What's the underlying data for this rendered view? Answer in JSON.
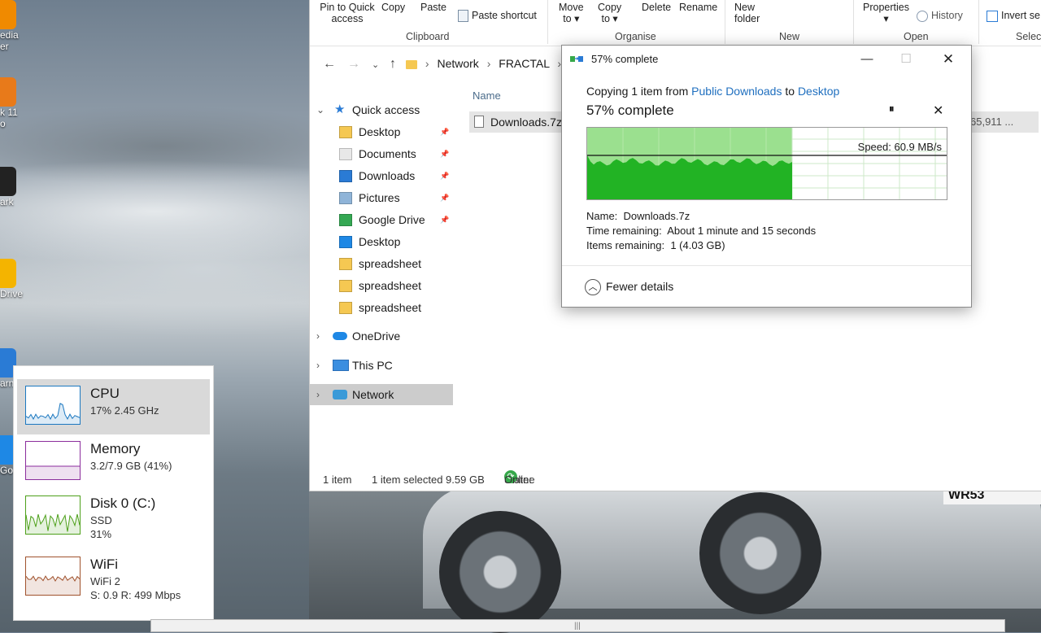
{
  "desktop": {
    "icons": [
      {
        "label": "edia\ner",
        "color": "#f08a00"
      },
      {
        "label": "k 11\no",
        "color": "#e87a1a"
      },
      {
        "label": "ark",
        "color": "#222222"
      },
      {
        "label": "Drive",
        "color": "#f4b400"
      },
      {
        "label": "arn",
        "color": "#2a7bd5"
      },
      {
        "label": "Go",
        "color": "#1e88e5"
      }
    ],
    "plate": "WR53"
  },
  "ribbon": {
    "pin": "Pin to Quick\naccess",
    "copy": "Copy",
    "paste": "Paste",
    "paste_shortcut": "Paste shortcut",
    "group_clipboard": "Clipboard",
    "move_to": "Move\nto ▾",
    "copy_to": "Copy\nto ▾",
    "delete": "Delete",
    "rename": "Rename",
    "group_organise": "Organise",
    "new_folder": "New\nfolder",
    "group_new": "New",
    "properties": "Properties\n▾",
    "history": "History",
    "group_open": "Open",
    "invert": "Invert se",
    "group_select": "Selec"
  },
  "address": {
    "parts": [
      "Network",
      "FRACTAL"
    ]
  },
  "nav": {
    "quick_access": "Quick access",
    "items": [
      {
        "label": "Desktop",
        "pinned": true,
        "icon_color": "#f5c852"
      },
      {
        "label": "Documents",
        "pinned": true,
        "icon_color": "#e8e8e8"
      },
      {
        "label": "Downloads",
        "pinned": true,
        "icon_color": "#2a7bd5"
      },
      {
        "label": "Pictures",
        "pinned": true,
        "icon_color": "#8fb4d8"
      },
      {
        "label": "Google Drive",
        "pinned": true,
        "icon_color": "#34a853"
      },
      {
        "label": "Desktop",
        "pinned": false,
        "icon_color": "#1e88e5"
      },
      {
        "label": "spreadsheet",
        "pinned": false,
        "icon_color": "#f5c852"
      },
      {
        "label": "spreadsheet",
        "pinned": false,
        "icon_color": "#f5c852"
      },
      {
        "label": "spreadsheet",
        "pinned": false,
        "icon_color": "#f5c852"
      }
    ],
    "onedrive": "OneDrive",
    "thispc": "This PC",
    "network": "Network"
  },
  "files": {
    "column_name": "Name",
    "rows": [
      {
        "name": "Downloads.7z",
        "size": "65,911 ..."
      }
    ]
  },
  "status": {
    "count": "1 item",
    "selected": "1 item selected  9.59 GB",
    "state_label": "State:",
    "state_value": "Online"
  },
  "copy_dialog": {
    "title": "57% complete",
    "copying_prefix": "Copying 1 item from ",
    "source": "Public Downloads",
    "to": " to ",
    "dest": "Desktop",
    "percent_text": "57% complete",
    "progress": 0.57,
    "speed": "Speed: 60.9 MB/s",
    "name_label": "Name:",
    "name_value": "Downloads.7z",
    "time_label": "Time remaining:",
    "time_value": "About 1 minute and 15 seconds",
    "items_label": "Items remaining:",
    "items_value": "1 (4.03 GB)",
    "fewer_details": "Fewer details",
    "pause_glyph": "⏸",
    "stop_glyph": "✕",
    "min_glyph": "—",
    "max_glyph": "☐",
    "close_glyph": "✕"
  },
  "taskmgr": {
    "items": [
      {
        "title": "CPU",
        "lines": [
          "17% 2.45 GHz"
        ],
        "color": "#1c78c0",
        "active": true
      },
      {
        "title": "Memory",
        "lines": [
          "3.2/7.9 GB (41%)"
        ],
        "color": "#8b2d9c",
        "active": false
      },
      {
        "title": "Disk 0 (C:)",
        "lines": [
          "SSD",
          "31%"
        ],
        "color": "#4da01a",
        "active": false
      },
      {
        "title": "WiFi",
        "lines": [
          "WiFi 2",
          "S: 0.9  R: 499 Mbps"
        ],
        "color": "#a0522d",
        "active": false
      }
    ]
  },
  "colors": {
    "accent": "#1f6fbf",
    "progress_fill": "#22b324",
    "progress_light": "#9be08f"
  }
}
